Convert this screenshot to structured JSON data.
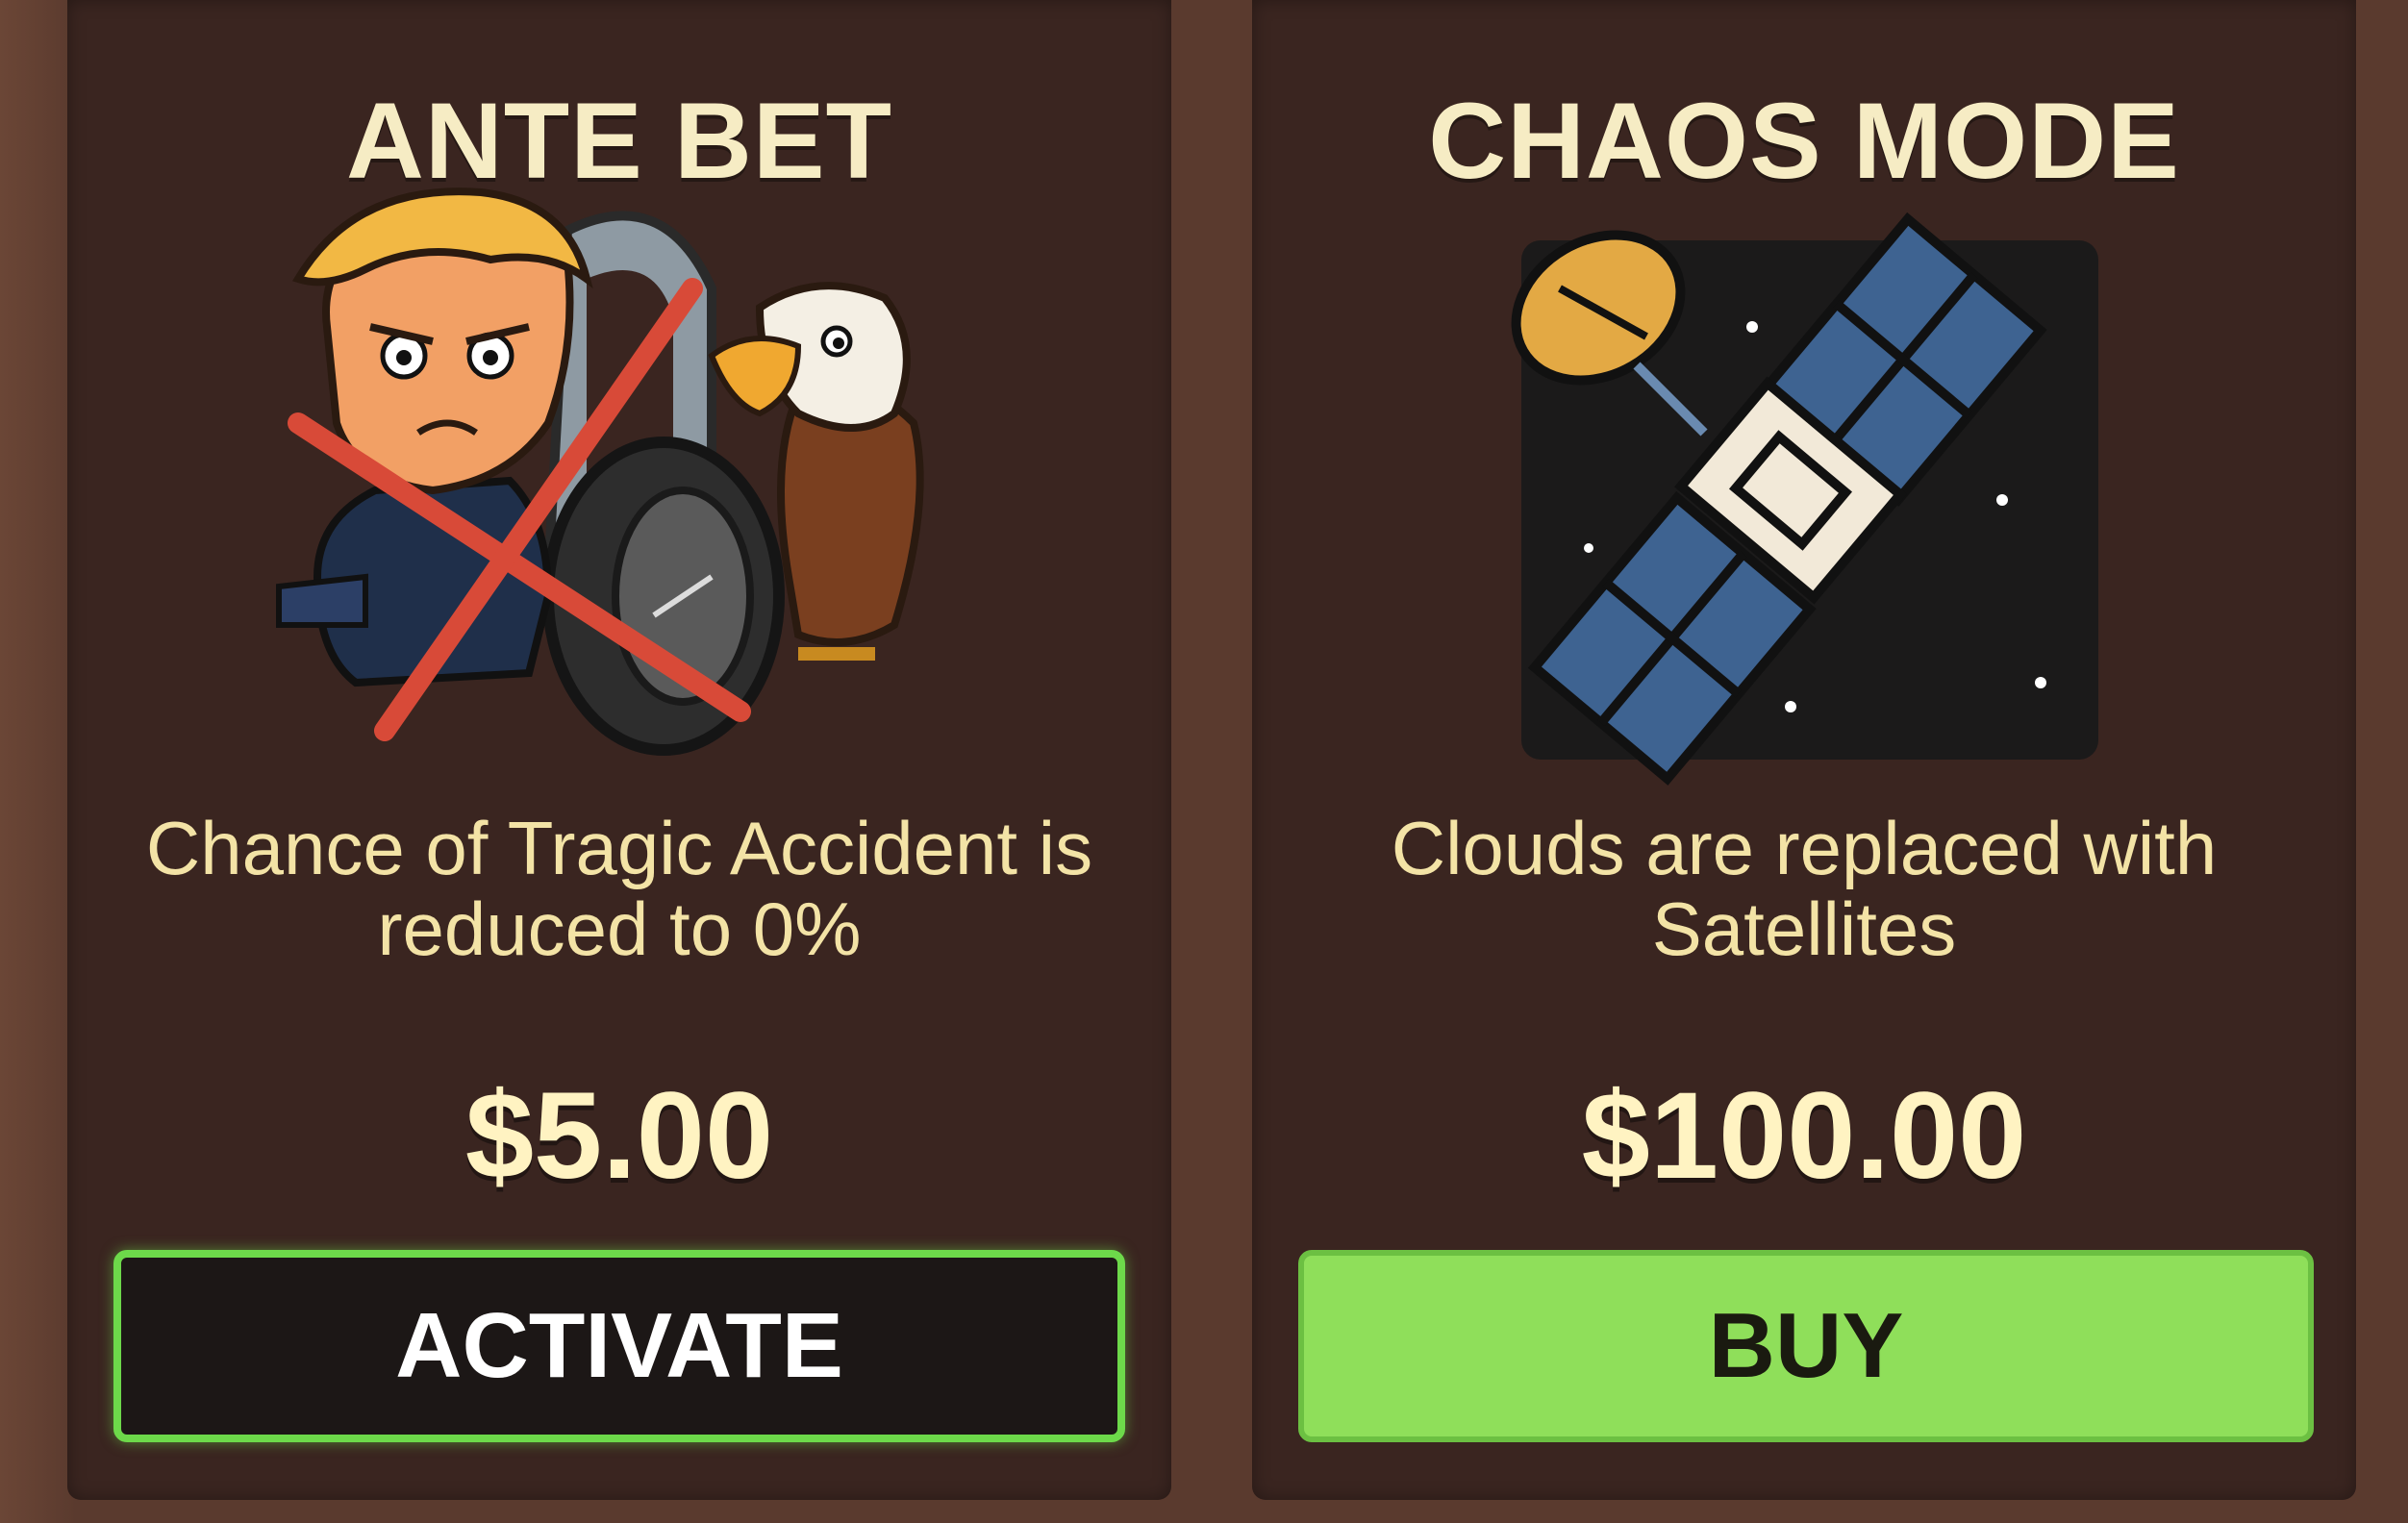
{
  "cards": {
    "ante": {
      "title": "ANTE BET",
      "description": "Chance of Tragic Accident is reduced to 0%",
      "price": "$5.00",
      "button_label": "ACTIVATE",
      "image": "president-eagle-tire-crossed-out"
    },
    "chaos": {
      "title": "CHAOS MODE",
      "description": "Clouds are replaced with Satellites",
      "price": "$100.00",
      "button_label": "BUY",
      "image": "satellite-icon"
    }
  },
  "colors": {
    "background": "#5a3a2e",
    "card": "#3a2520",
    "title": "#f6ecc4",
    "accent_green": "#8fdf5a",
    "active_border": "#6dd94a"
  }
}
